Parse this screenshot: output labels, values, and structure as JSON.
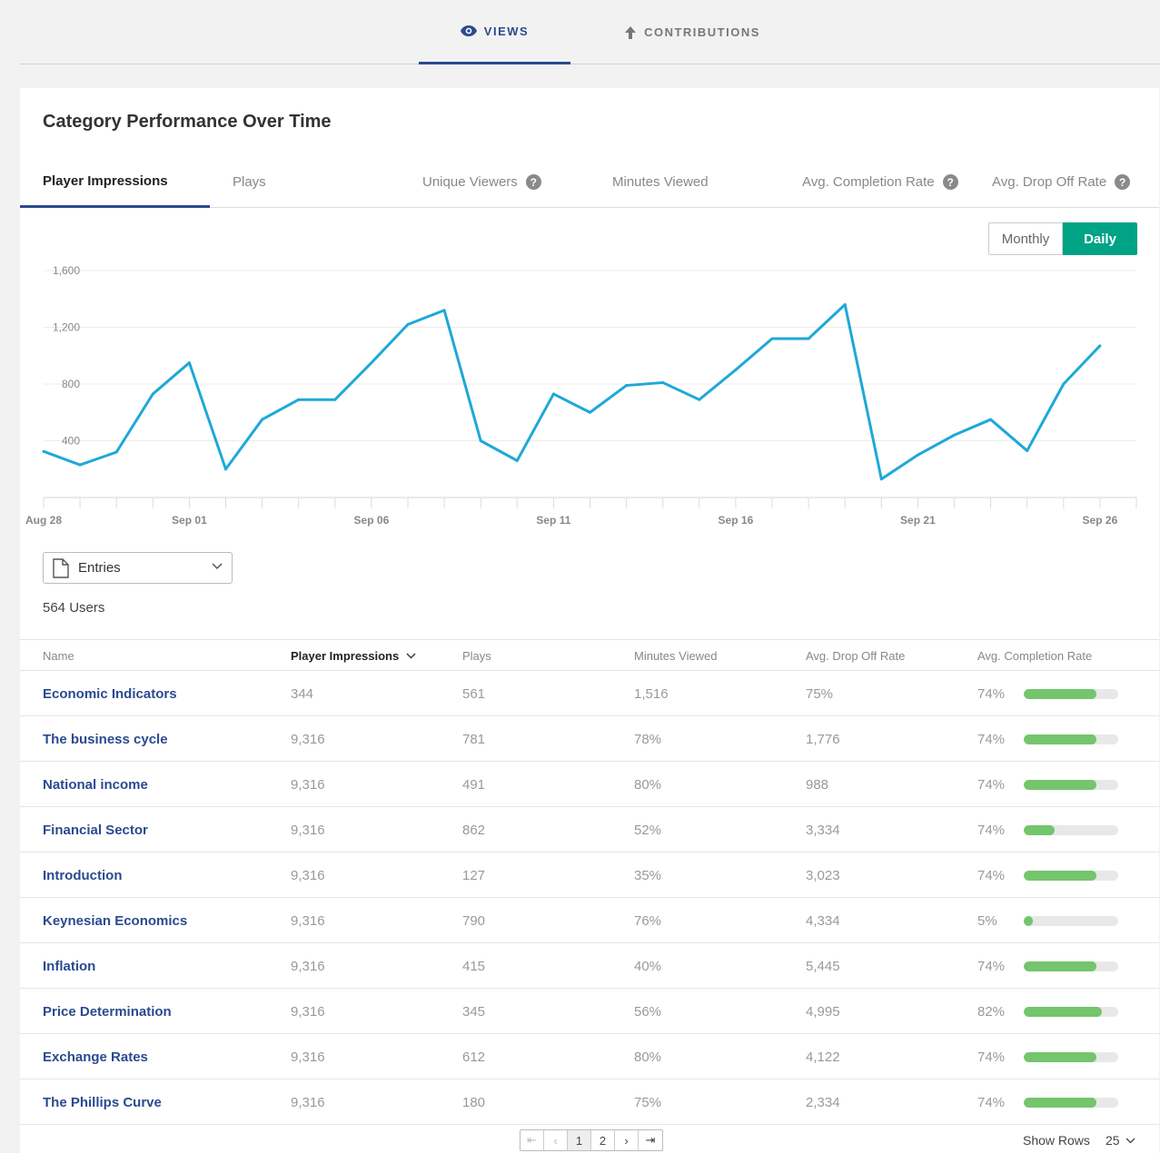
{
  "top_tabs": [
    {
      "label": "VIEWS",
      "icon": "eye-icon",
      "active": true
    },
    {
      "label": "CONTRIBUTIONS",
      "icon": "arrow-up-icon",
      "active": false
    }
  ],
  "card": {
    "title": "Category Performance Over Time"
  },
  "metric_tabs": [
    {
      "label": "Player Impressions",
      "active": true,
      "help": false
    },
    {
      "label": "Plays",
      "active": false,
      "help": false
    },
    {
      "label": "Unique Viewers",
      "active": false,
      "help": true
    },
    {
      "label": "Minutes Viewed",
      "active": false,
      "help": false
    },
    {
      "label": "Avg. Completion Rate",
      "active": false,
      "help": true
    },
    {
      "label": "Avg. Drop Off Rate",
      "active": false,
      "help": true
    }
  ],
  "help_glyph": "?",
  "period_toggle": {
    "monthly": "Monthly",
    "daily": "Daily",
    "selected": "Daily",
    "selected_color": "#00a385"
  },
  "chart_data": {
    "type": "line",
    "x": [
      "Aug 28",
      "Aug 29",
      "Aug 30",
      "Aug 31",
      "Sep 01",
      "Sep 02",
      "Sep 03",
      "Sep 04",
      "Sep 05",
      "Sep 06",
      "Sep 07",
      "Sep 08",
      "Sep 09",
      "Sep 10",
      "Sep 11",
      "Sep 12",
      "Sep 13",
      "Sep 14",
      "Sep 15",
      "Sep 16",
      "Sep 17",
      "Sep 18",
      "Sep 19",
      "Sep 20",
      "Sep 21",
      "Sep 22",
      "Sep 23",
      "Sep 24",
      "Sep 25",
      "Sep 26",
      "Sep 27"
    ],
    "series": [
      {
        "values": [
          325,
          230,
          320,
          730,
          950,
          200,
          550,
          690,
          690,
          950,
          1220,
          1320,
          400,
          260,
          730,
          600,
          790,
          810,
          690,
          900,
          1120,
          1120,
          1360,
          130,
          300,
          440,
          550,
          330,
          800,
          1070
        ],
        "color": "#1fa8d8"
      }
    ],
    "y_ticks": [
      "400",
      "800",
      "1,200",
      "1,600"
    ],
    "x_tick_labels": [
      "Aug 28",
      "Sep 01",
      "Sep 06",
      "Sep 11",
      "Sep 16",
      "Sep 21",
      "Sep 26"
    ],
    "ylim": [
      0,
      1600
    ],
    "grid": true,
    "title": "",
    "xlabel": "",
    "ylabel": ""
  },
  "entries_select": {
    "label": "Entries",
    "icon": "document-icon"
  },
  "users_count": "564 Users",
  "table": {
    "columns": [
      "Name",
      "Player Impressions",
      "Plays",
      "Minutes Viewed",
      "Avg. Drop Off Rate",
      "Avg. Completion Rate"
    ],
    "sorted_column": "Player Impressions",
    "rows": [
      {
        "name": "Economic Indicators",
        "impressions": "344",
        "plays": "561",
        "minutes": "1,516",
        "dropoff": "75%",
        "completion": "74%",
        "completion_value": 0.77
      },
      {
        "name": "The business cycle",
        "impressions": "9,316",
        "plays": "781",
        "minutes": "78%",
        "dropoff": "1,776",
        "completion": "74%",
        "completion_value": 0.77
      },
      {
        "name": "National income",
        "impressions": "9,316",
        "plays": "491",
        "minutes": "80%",
        "dropoff": "988",
        "completion": "74%",
        "completion_value": 0.77
      },
      {
        "name": "Financial Sector",
        "impressions": "9,316",
        "plays": "862",
        "minutes": "52%",
        "dropoff": "3,334",
        "completion": "74%",
        "completion_value": 0.33
      },
      {
        "name": "Introduction",
        "impressions": "9,316",
        "plays": "127",
        "minutes": "35%",
        "dropoff": "3,023",
        "completion": "74%",
        "completion_value": 0.77
      },
      {
        "name": "Keynesian Economics",
        "impressions": "9,316",
        "plays": "790",
        "minutes": "76%",
        "dropoff": "4,334",
        "completion": "5%",
        "completion_value": 0.1
      },
      {
        "name": "Inflation",
        "impressions": "9,316",
        "plays": "415",
        "minutes": "40%",
        "dropoff": "5,445",
        "completion": "74%",
        "completion_value": 0.77
      },
      {
        "name": "Price Determination",
        "impressions": "9,316",
        "plays": "345",
        "minutes": "56%",
        "dropoff": "4,995",
        "completion": "82%",
        "completion_value": 0.83
      },
      {
        "name": "Exchange Rates",
        "impressions": "9,316",
        "plays": "612",
        "minutes": "80%",
        "dropoff": "4,122",
        "completion": "74%",
        "completion_value": 0.77
      },
      {
        "name": "The Phillips Curve",
        "impressions": "9,316",
        "plays": "180",
        "minutes": "75%",
        "dropoff": "2,334",
        "completion": "74%",
        "completion_value": 0.77
      }
    ]
  },
  "pagination": {
    "first": "⇤",
    "prev": "‹",
    "pages": [
      "1",
      "2"
    ],
    "current": "1",
    "next": "›",
    "last": "⇥"
  },
  "show_rows": {
    "label": "Show Rows",
    "value": "25"
  },
  "colors": {
    "accent": "#2b4a8f",
    "line": "#1fa8d8",
    "bar_fill": "#74c56c",
    "toggle_active": "#00a385"
  }
}
